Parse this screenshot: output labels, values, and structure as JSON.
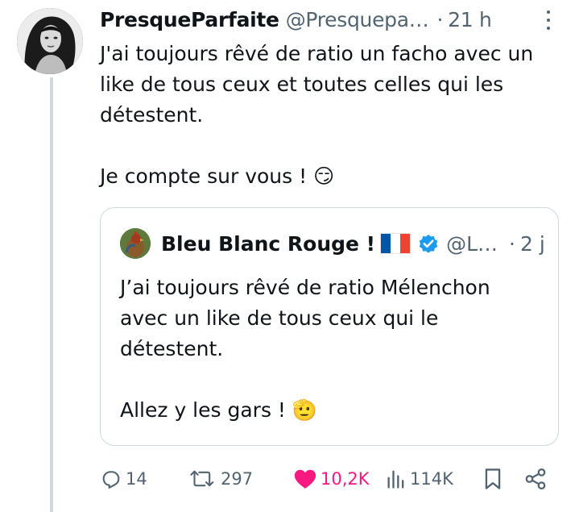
{
  "tweet": {
    "author_name": "PresqueParfaite",
    "author_handle": "@Presquepa…",
    "time": "21 h",
    "separator": "·",
    "text": "J'ai toujours rêvé de ratio un facho avec un like de tous ceux et toutes celles qui les détestent.\n\nJe compte sur vous ! 😏",
    "avatar_icon": "profile-photo"
  },
  "quoted_tweet": {
    "author_name": "Bleu Blanc Rouge !",
    "author_handle": "@L…",
    "time": "2 j",
    "separator": "·",
    "text": "J’ai toujours rêvé de ratio Mélenchon avec un like de tous ceux qui le détestent.\n\nAllez y les gars ! 🫡",
    "flag_colors": [
      "#0055a4",
      "#ffffff",
      "#ef4135"
    ],
    "verified_color": "#1d9bf0"
  },
  "actions": {
    "replies": "14",
    "reposts": "297",
    "likes": "10,2K",
    "views": "114K",
    "like_color": "#f91880",
    "icon_color": "#536471"
  }
}
